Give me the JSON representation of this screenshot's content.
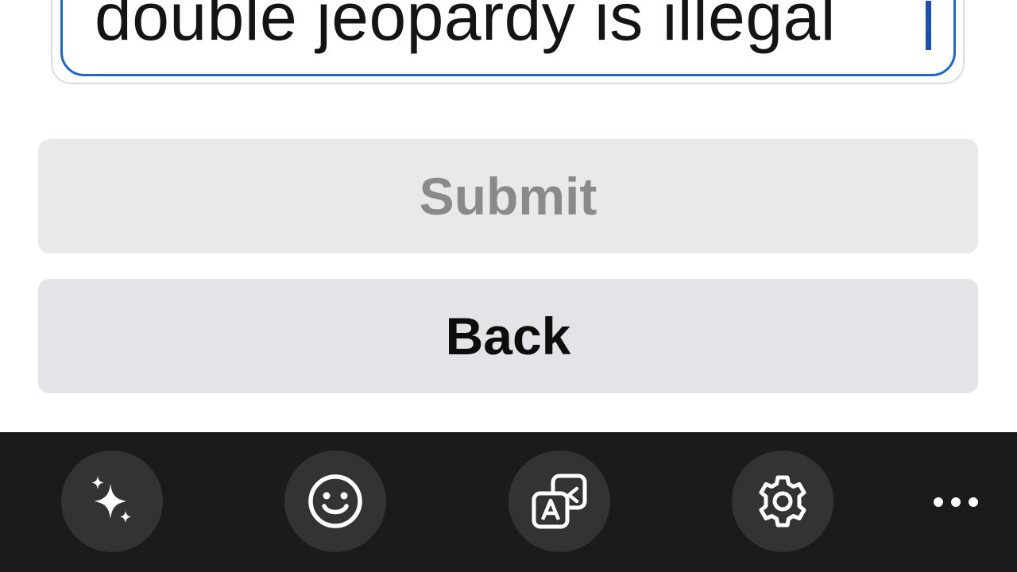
{
  "input": {
    "value": "double jeopardy is illegal"
  },
  "buttons": {
    "submit_label": "Submit",
    "back_label": "Back"
  },
  "toolbar": {
    "items": [
      {
        "icon": "sparkles-icon"
      },
      {
        "icon": "emoji-icon"
      },
      {
        "icon": "translate-icon"
      },
      {
        "icon": "gear-icon"
      },
      {
        "icon": "more-icon"
      }
    ]
  },
  "colors": {
    "focus_border": "#1a66d4",
    "caret": "#1a4fb3",
    "submit_bg": "#e8e9eb",
    "submit_text": "#8a8a8a",
    "back_bg": "#e2e4e7",
    "back_text": "#0d0d0d",
    "toolbar_bg": "#1b1b1d",
    "toolbar_button_bg": "#333335"
  }
}
